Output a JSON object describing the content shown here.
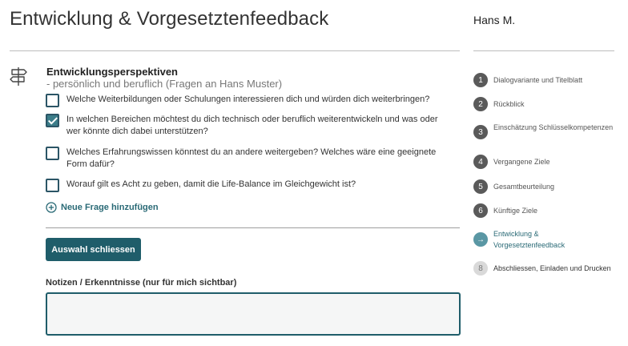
{
  "header": {
    "title": "Entwicklung & Vorgesetztenfeedback",
    "user": "Hans M."
  },
  "section": {
    "icon": "signpost-icon",
    "title": "Entwicklungsperspektiven",
    "subtitle": "- persönlich und beruflich (Fragen an Hans Muster)"
  },
  "questions": [
    {
      "text": "Welche Weiterbildungen oder Schulungen interessieren dich und würden dich weiterbringen?",
      "checked": false
    },
    {
      "text": "In welchen Bereichen möchtest du dich technisch oder beruflich weiterentwickeln und was oder wer könnte dich dabei unterstützen?",
      "checked": true
    },
    {
      "text": "Welches Erfahrungswissen könntest du an andere weitergeben? Welches wäre eine geeignete Form dafür?",
      "checked": false
    },
    {
      "text": "Worauf gilt es Acht zu geben, damit die Life-Balance im Gleichgewicht ist?",
      "checked": false
    }
  ],
  "add_question_label": "Neue Frage hinzufügen",
  "close_button_label": "Auswahl schliessen",
  "notes": {
    "label": "Notizen / Erkenntnisse (nur für mich sichtbar)",
    "value": ""
  },
  "steps": [
    {
      "num": "1",
      "label": "Dialogvariante und Titelblatt",
      "state": "done"
    },
    {
      "num": "2",
      "label": "Rückblick",
      "state": "done"
    },
    {
      "num": "3",
      "label": "Einschätzung Schlüsselkompetenzen",
      "state": "done"
    },
    {
      "num": "4",
      "label": "Vergangene Ziele",
      "state": "done"
    },
    {
      "num": "5",
      "label": "Gesamtbeurteilung",
      "state": "done"
    },
    {
      "num": "6",
      "label": "Künftige Ziele",
      "state": "done"
    },
    {
      "num": "→",
      "label": "Entwicklung & Vorgesetztenfeedback",
      "state": "active"
    },
    {
      "num": "8",
      "label": "Abschliessen, Einladen und Drucken",
      "state": "pending"
    }
  ],
  "colors": {
    "accent": "#1f5d6a",
    "active_step": "#5a97a4",
    "checked_box": "#3b7d89"
  }
}
